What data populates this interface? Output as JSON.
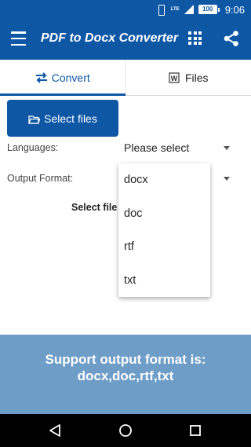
{
  "status_bar": {
    "network": "LTE",
    "battery": "100",
    "time": "9:06"
  },
  "app_bar": {
    "title": "PDF to Docx Converter"
  },
  "tabs": [
    {
      "label": "Convert",
      "icon": "swap-arrows-icon",
      "active": true
    },
    {
      "label": "Files",
      "icon": "word-file-icon",
      "active": false
    }
  ],
  "select_files_button": {
    "label": "Select files",
    "icon": "folder-icon"
  },
  "languages": {
    "label": "Languages:",
    "value": "Please select"
  },
  "output_format": {
    "label": "Output Format:"
  },
  "hint_text": "Select file",
  "dropdown": {
    "options": [
      "docx",
      "doc",
      "rtf",
      "txt"
    ]
  },
  "support_banner": {
    "line1": "Support output format is:",
    "line2": "docx,doc,rtf,txt"
  },
  "colors": {
    "primary": "#0d57a5",
    "banner": "#6e9dc8"
  },
  "nav_bar": {
    "icons": [
      "back-icon",
      "home-icon",
      "recents-icon"
    ]
  }
}
